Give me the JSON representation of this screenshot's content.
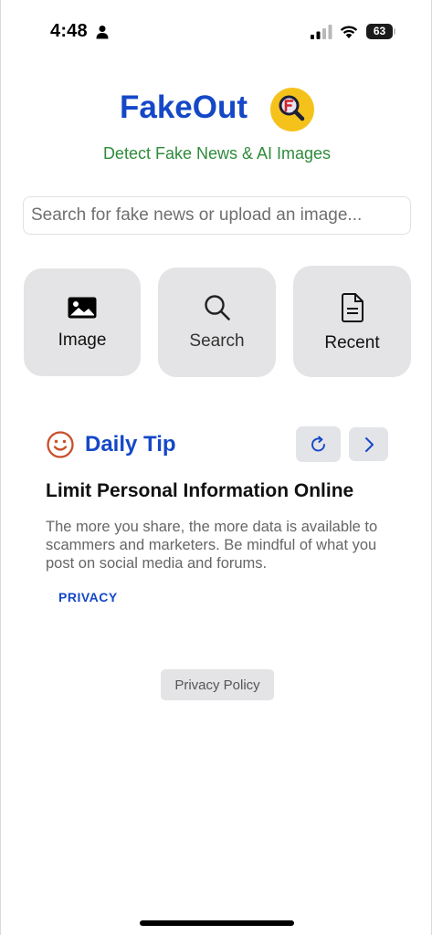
{
  "status_bar": {
    "time": "4:48",
    "battery_level": "63",
    "icons": [
      "person-icon",
      "signal-icon",
      "wifi-icon",
      "battery-icon"
    ]
  },
  "header": {
    "app_name": "FakeOut",
    "tagline": "Detect Fake News & AI Images",
    "logo_icon": "magnifier-logo-icon"
  },
  "search": {
    "placeholder": "Search for fake news or upload an image...",
    "value": ""
  },
  "actions": [
    {
      "label": "Image",
      "icon": "image-icon"
    },
    {
      "label": "Search",
      "icon": "search-icon"
    },
    {
      "label": "Recent",
      "icon": "document-icon"
    }
  ],
  "daily_tip": {
    "title": "Daily Tip",
    "icon": "smile-icon",
    "heading": "Limit Personal Information Online",
    "body": "The more you share, the more data is available to scammers and marketers. Be mindful of what you post on social media and forums.",
    "tag": "PRIVACY",
    "buttons": [
      "refresh-icon",
      "chevron-right-icon"
    ]
  },
  "footer": {
    "privacy_label": "Privacy Policy"
  },
  "colors": {
    "brand_blue": "#1548c7",
    "tagline_green": "#2e8b3a",
    "tip_icon_orange": "#c8502a",
    "logo_yellow": "#f4c21a",
    "tile_gray": "#e4e4e6"
  }
}
